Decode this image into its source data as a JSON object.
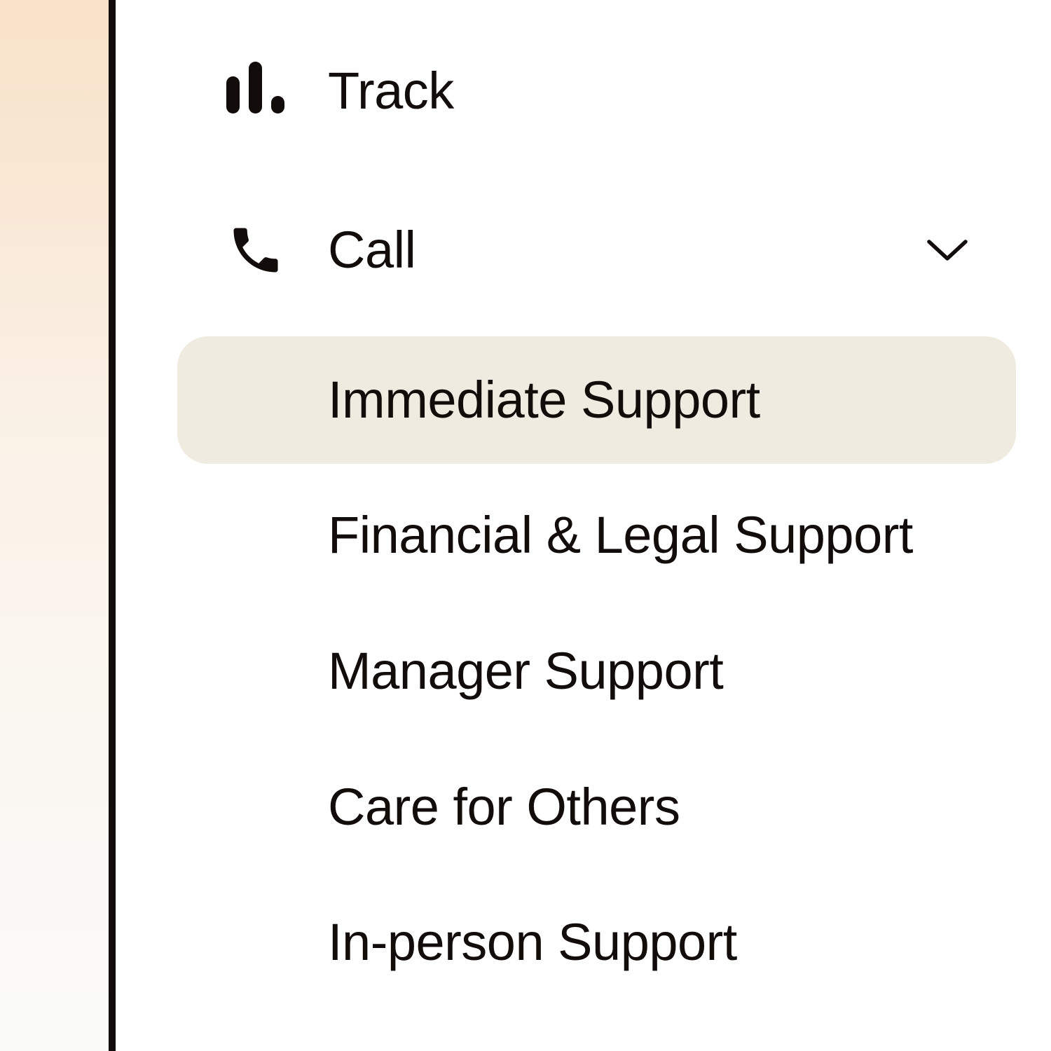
{
  "nav": {
    "track": {
      "label": "Track",
      "icon": "bar-chart-icon"
    },
    "call": {
      "label": "Call",
      "icon": "phone-icon",
      "expanded": true,
      "submenu": [
        {
          "label": "Immediate Support",
          "active": true
        },
        {
          "label": "Financial & Legal Support",
          "active": false
        },
        {
          "label": "Manager Support",
          "active": false
        },
        {
          "label": "Care for Others",
          "active": false
        },
        {
          "label": "In-person Support",
          "active": false
        }
      ]
    }
  },
  "colors": {
    "text": "#120c0a",
    "active_background": "#f0ebe0",
    "divider": "#120c0a",
    "left_panel_top": "#f8e2c8",
    "left_panel_bottom": "#fafaf8"
  }
}
